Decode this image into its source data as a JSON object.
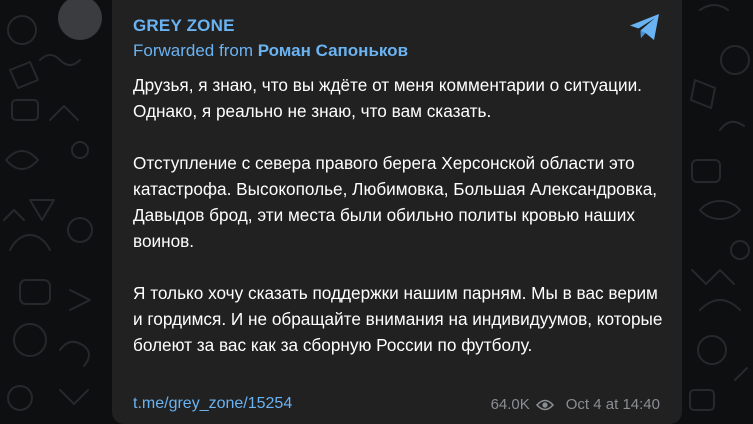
{
  "channel": {
    "name": "GREY ZONE"
  },
  "forward": {
    "prefix": "Forwarded from",
    "author": "Роман Сапоньков"
  },
  "message": {
    "paragraphs": [
      "Друзья, я знаю, что вы ждёте от меня комментарии о ситуации. Однако, я реально не знаю, что вам сказать.",
      "Отступление с севера правого берега Херсонской области это катастрофа. Высокополье, Любимовка, Большая Александровка, Давыдов брод, эти места были обильно политы кровью наших воинов.",
      "Я только хочу сказать поддержки нашим парням. Мы в вас верим и гордимся. И не обращайте внимания на индивидуумов, которые болеют за вас как за сборную России по футболу."
    ]
  },
  "footer": {
    "link": "t.me/grey_zone/15254",
    "views": "64.0K",
    "date": "Oct 4 at 14:40"
  },
  "icons": {
    "share": "telegram-plane-icon",
    "views": "eye-icon"
  },
  "colors": {
    "accent": "#6ab3f3",
    "bubble": "#212121",
    "background": "#0e0f11",
    "meta_text": "#8a8e93"
  }
}
